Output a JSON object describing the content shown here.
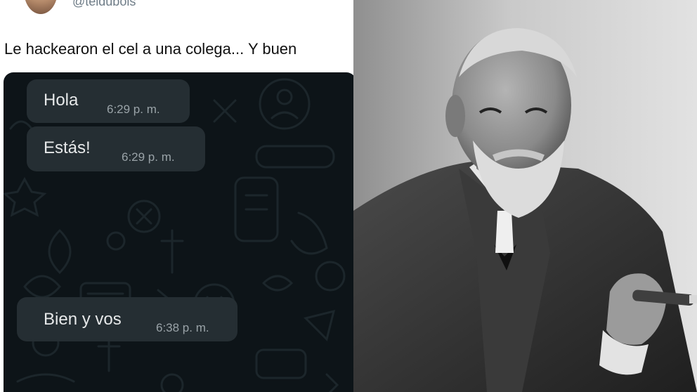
{
  "tweet": {
    "handle": "@teldubois",
    "text": "Le hackearon el cel a una colega... Y buen"
  },
  "chat": {
    "messages": [
      {
        "text": "Hola",
        "time": "6:29 p. m."
      },
      {
        "text": "Estás!",
        "time": "6:29 p. m."
      },
      {
        "text": "Bien y vos",
        "time": "6:38 p. m."
      }
    ]
  },
  "colors": {
    "chat_background": "#0d1418",
    "bubble": "#252e33",
    "bubble_text": "#e6e8e9",
    "timestamp": "#9aa3a8"
  },
  "photo": {
    "subject": "portrait-photo",
    "style": "black-and-white"
  }
}
